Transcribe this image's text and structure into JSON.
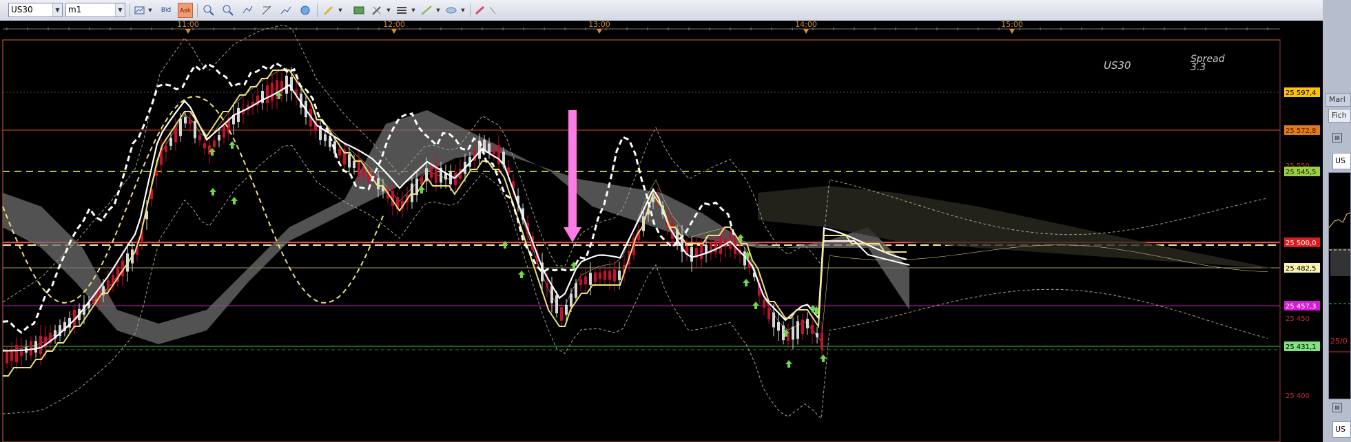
{
  "toolbar": {
    "symbol": "US30",
    "timeframe": "m1",
    "bid_label": "Bid",
    "ask_label": "Ask"
  },
  "chart": {
    "symbol_label": "US30",
    "spread_label": "Spread",
    "spread_value": "3.3",
    "time_labels": [
      "11:00",
      "12:00",
      "13:00",
      "14:00",
      "15:00"
    ],
    "y_ticks": [
      "25 550",
      "25 450",
      "25 400"
    ],
    "level_tags": [
      "25 597,4",
      "25 572,8",
      "25 545,5",
      "25 500,0",
      "25 482,5",
      "25 457,3",
      "25 431,1"
    ],
    "colors": {
      "background": "#000000",
      "bull_candle": "#d8d8d8",
      "bear_candle": "#c8102e",
      "tenkan_line": "#ffffff",
      "kijun_line": "#f0e27a",
      "cloud": "#6e6e6e",
      "signal_arrow": "#ff7be6",
      "up_arrows": "#6cd84a"
    }
  },
  "side_panel": {
    "tab_label": "Marl",
    "menu_label": "Fich",
    "symbol_fragment": "US",
    "date_fragment": "25/0",
    "symbol_fragment_2": "US"
  }
}
